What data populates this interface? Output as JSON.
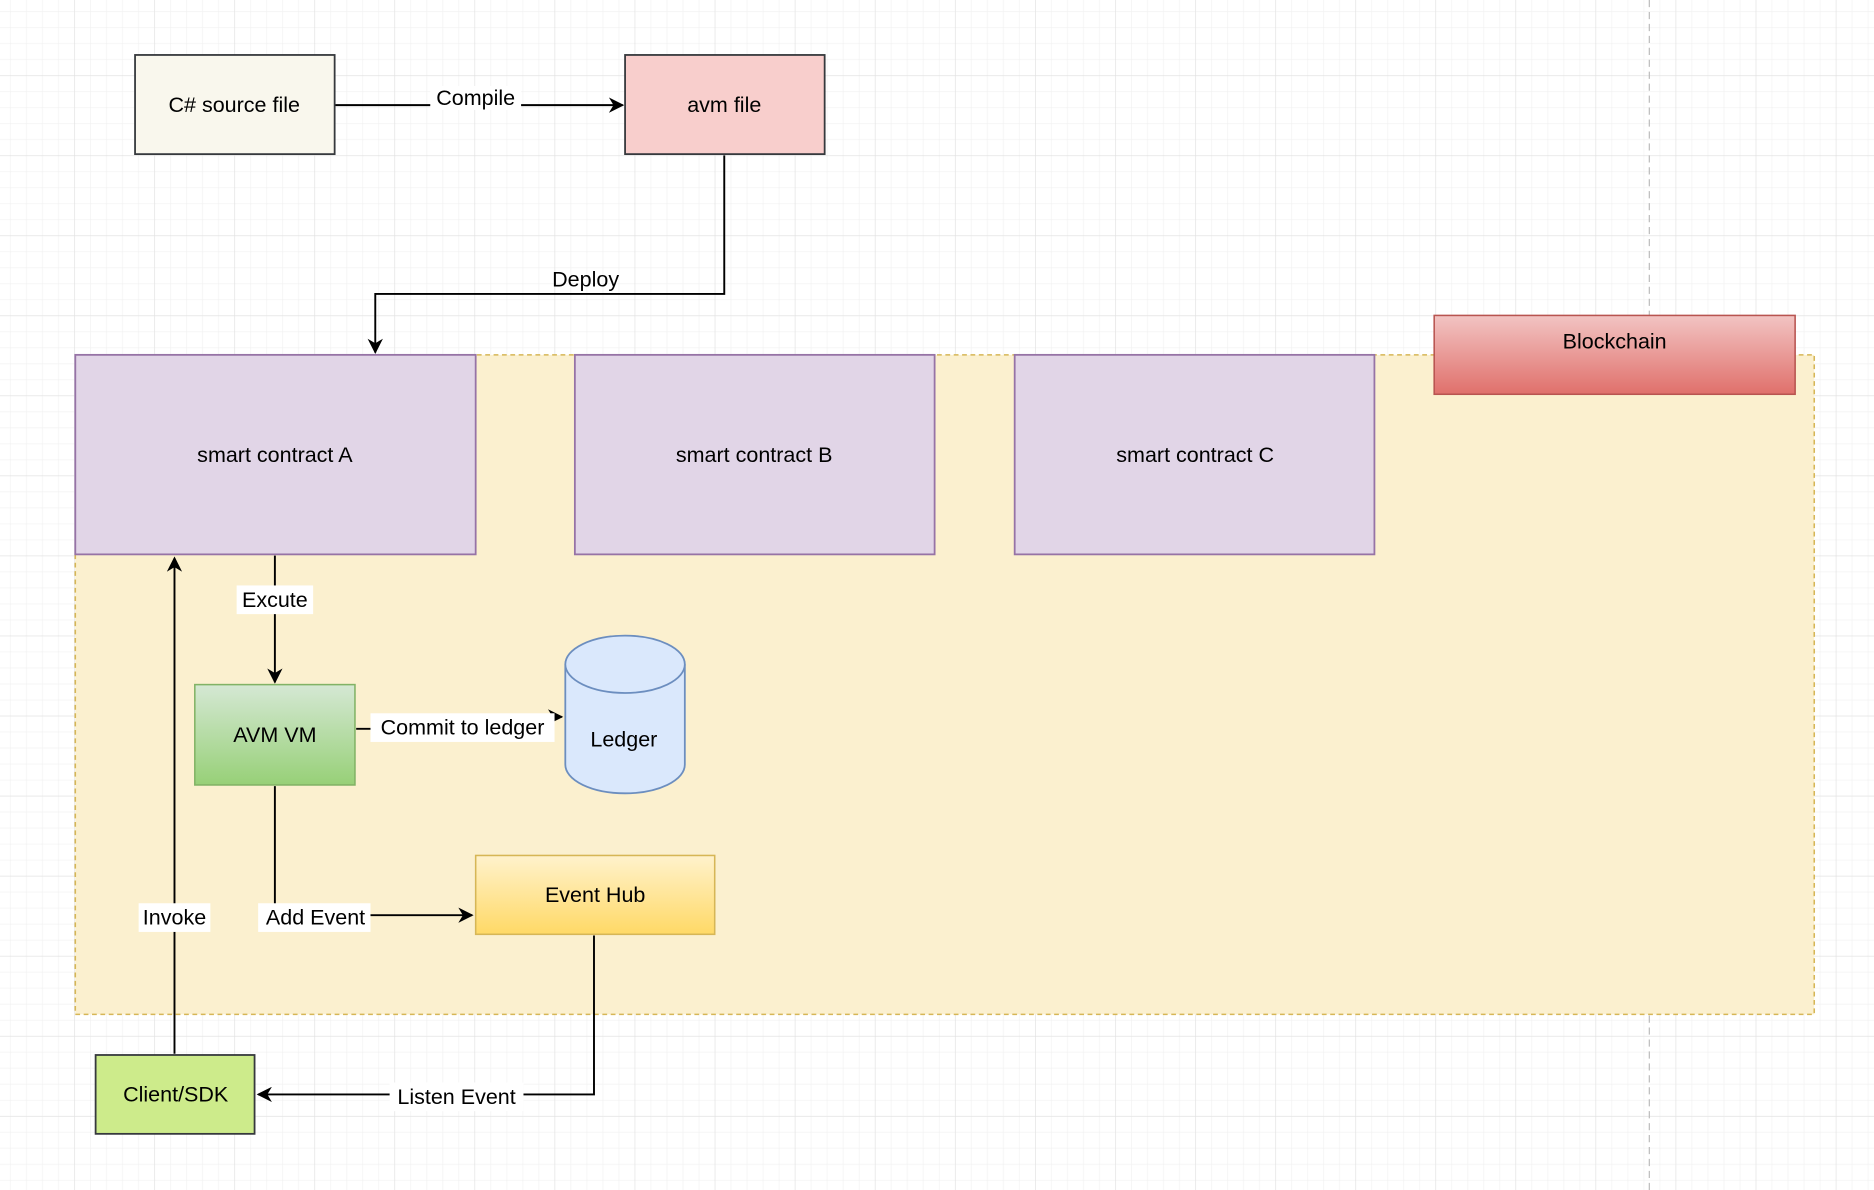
{
  "nodes": {
    "csharp": {
      "label": "C# source file",
      "fill": "#f9f7ed",
      "stroke": "#36393d"
    },
    "avm_file": {
      "label": "avm file",
      "fill": "#f8cecc",
      "stroke": "#36393d"
    },
    "contract_a": {
      "label": "smart contract A",
      "fill": "#e1d5e7",
      "stroke": "#9673a6"
    },
    "contract_b": {
      "label": "smart contract B",
      "fill": "#e1d5e7",
      "stroke": "#9673a6"
    },
    "contract_c": {
      "label": "smart contract C",
      "fill": "#e1d5e7",
      "stroke": "#9673a6"
    },
    "blockchain": {
      "label": "Blockchain",
      "fill": "#ea6b66",
      "stroke": "#b85450"
    },
    "avm_vm": {
      "label": "AVM VM",
      "fill": "#97d077",
      "stroke": "#82b366"
    },
    "ledger": {
      "label": "Ledger",
      "fill": "#dae8fc",
      "stroke": "#6c8ebf"
    },
    "event_hub": {
      "label": "Event Hub",
      "fill": "#ffd966",
      "stroke": "#d6b656"
    },
    "client": {
      "label": "Client/SDK",
      "fill": "#cdeb8b",
      "stroke": "#36393d"
    },
    "container": {
      "fill": "#fbf0cf",
      "stroke": "#d6b656"
    }
  },
  "edges": {
    "compile": "Compile",
    "deploy": "Deploy",
    "excute": "Excute",
    "commit": "Commit to ledger",
    "add_event": "Add Event",
    "invoke": "Invoke",
    "listen": "Listen Event"
  }
}
